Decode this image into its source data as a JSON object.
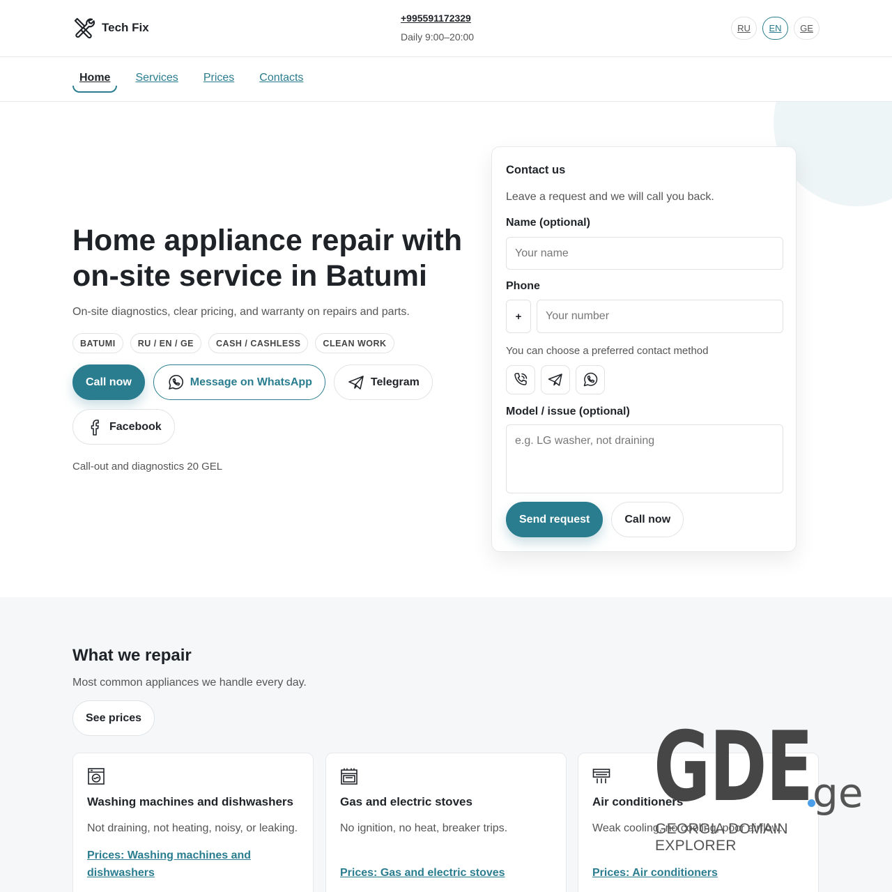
{
  "header": {
    "brand": "Tech Fix",
    "phone": "+995591172329",
    "hours": "Daily 9:00–20:00",
    "languages": [
      "RU",
      "EN",
      "GE"
    ],
    "active_language": "EN"
  },
  "nav": {
    "items": [
      "Home",
      "Services",
      "Prices",
      "Contacts"
    ],
    "active": "Home"
  },
  "hero": {
    "title": "Home appliance repair with on-site service in Batumi",
    "subtitle": "On-site diagnostics, clear pricing, and warranty on repairs and parts.",
    "tags": [
      "BATUMI",
      "RU / EN / GE",
      "CASH / CASHLESS",
      "CLEAN WORK"
    ],
    "buttons": {
      "call": "Call now",
      "whatsapp": "Message on WhatsApp",
      "telegram": "Telegram",
      "facebook": "Facebook"
    },
    "note": "Call-out and diagnostics 20 GEL"
  },
  "contact_form": {
    "title": "Contact us",
    "subtitle": "Leave a request and we will call you back.",
    "name_label": "Name (optional)",
    "name_placeholder": "Your name",
    "phone_label": "Phone",
    "phone_prefix": "+",
    "phone_placeholder": "Your number",
    "method_hint": "You can choose a preferred contact method",
    "methods": [
      "phone-icon",
      "telegram-icon",
      "whatsapp-icon"
    ],
    "issue_label": "Model / issue (optional)",
    "issue_placeholder": "e.g. LG washer, not draining",
    "submit": "Send request",
    "call": "Call now"
  },
  "repair": {
    "title": "What we repair",
    "subtitle": "Most common appliances we handle every day.",
    "see_prices": "See prices",
    "services": [
      {
        "icon": "washing-machine-icon",
        "title": "Washing machines and dishwashers",
        "description": "Not draining, not heating, noisy, or leaking.",
        "link": "Prices: Washing machines and dishwashers"
      },
      {
        "icon": "stove-icon",
        "title": "Gas and electric stoves",
        "description": "No ignition, no heat, breaker trips.",
        "link": "Prices: Gas and electric stoves"
      },
      {
        "icon": "air-conditioner-icon",
        "title": "Air conditioners",
        "description": "Weak cooling, no cooling, poor airflow.",
        "link": "Prices: Air conditioners"
      }
    ]
  },
  "watermark": {
    "logo": "GDE",
    "suffix": "ge",
    "tagline": "GEORGIA DOMAIN EXPLORER"
  },
  "colors": {
    "accent": "#2a7d8f",
    "text": "#1f2328",
    "muted": "#555555",
    "border": "#dfe3e6",
    "section_bg": "#f5f7f8"
  }
}
